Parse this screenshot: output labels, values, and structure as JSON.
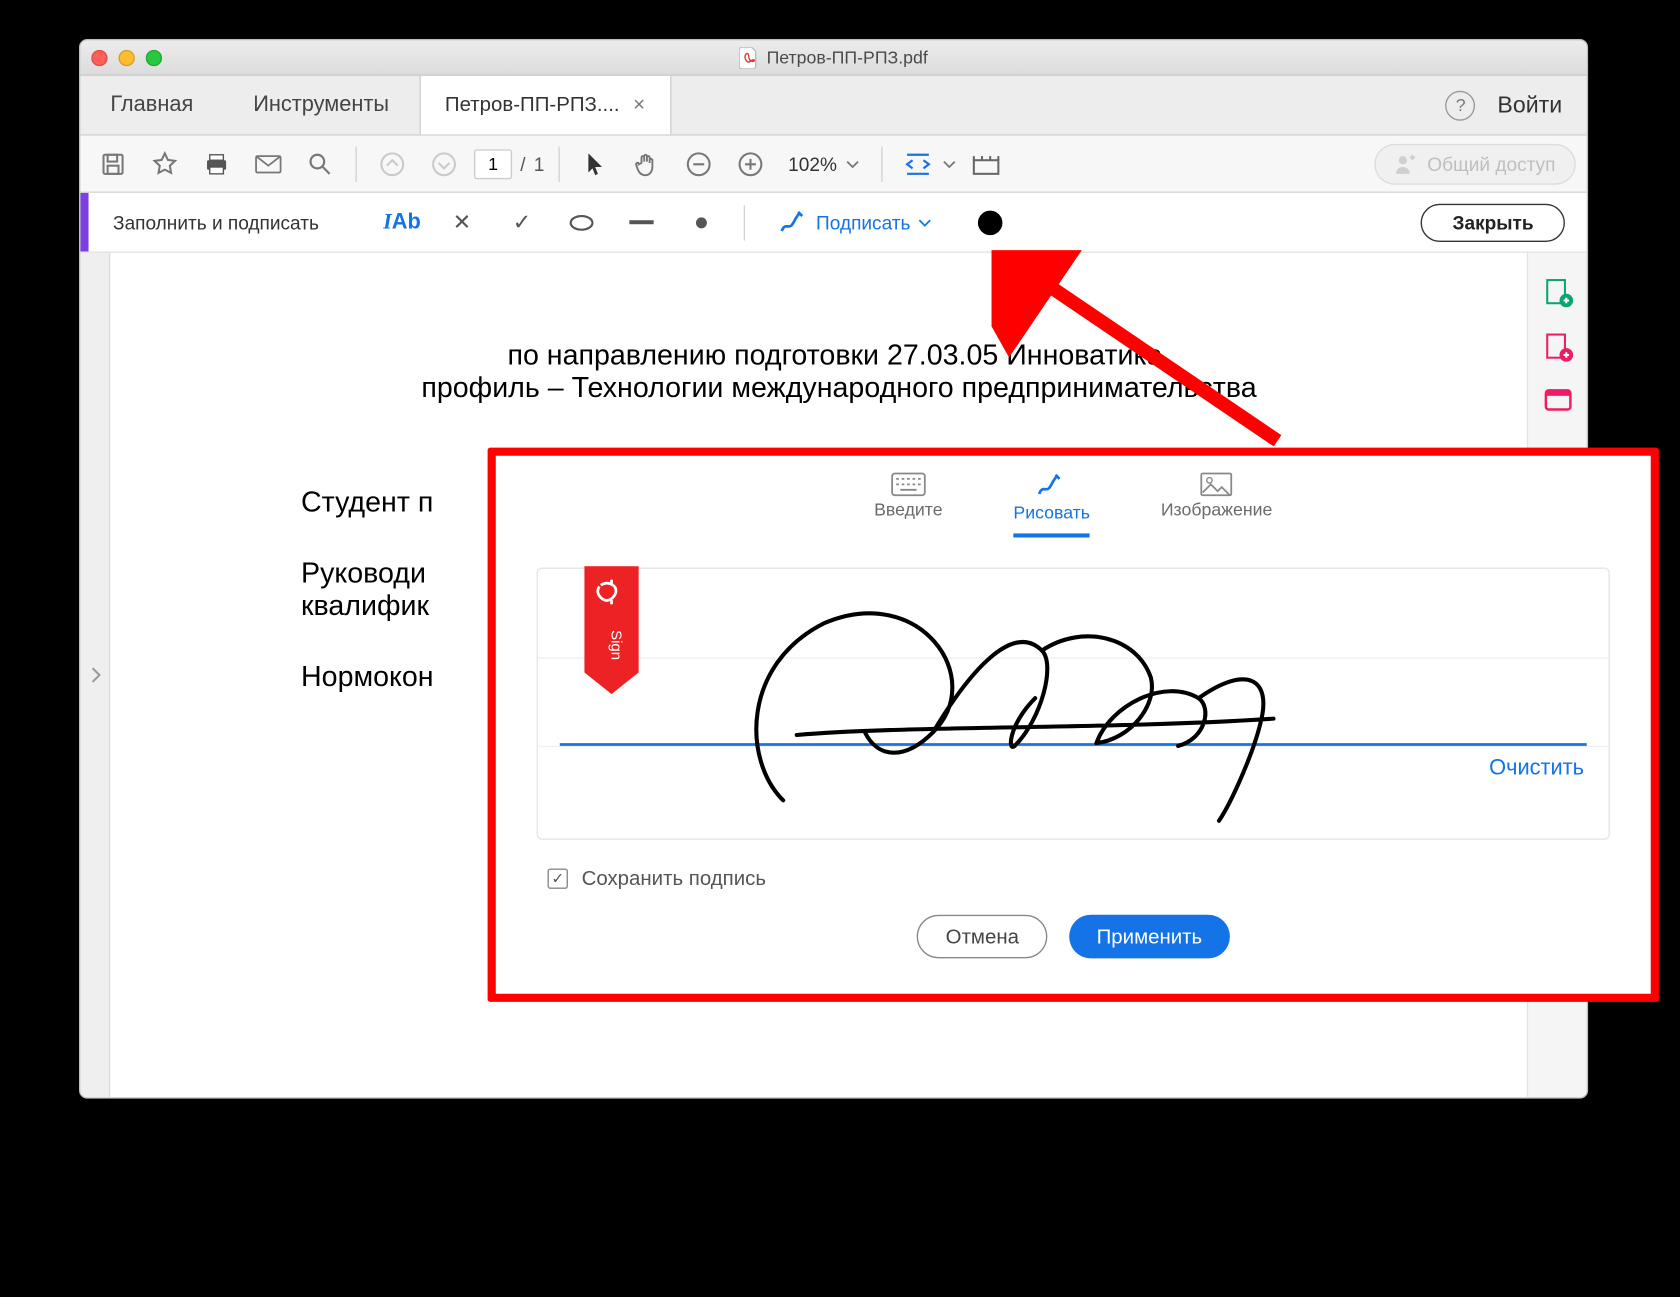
{
  "window": {
    "title": "Петров-ПП-РПЗ.pdf"
  },
  "tabs": {
    "home": "Главная",
    "tools": "Инструменты",
    "active": "Петров-ПП-РПЗ....",
    "login": "Войти"
  },
  "toolbar": {
    "page_current": "1",
    "page_sep": "/",
    "page_total": "1",
    "zoom": "102%",
    "share": "Общий доступ"
  },
  "fillsign": {
    "title": "Заполнить и подписать",
    "ab_label": "Ab",
    "sign": "Подписать",
    "close": "Закрыть"
  },
  "document": {
    "line1": "по направлению подготовки 27.03.05 Инноватика,",
    "line2": "профиль – Технологии международного предпринимательства",
    "student": "Студент п",
    "supervisor1": "Руководи",
    "supervisor2": "квалифик",
    "norm": "Нормокон"
  },
  "dialog": {
    "tab_type": "Введите",
    "tab_draw": "Рисовать",
    "tab_image": "Изображение",
    "clear": "Очистить",
    "save_checkbox": "Сохранить подпись",
    "cancel": "Отмена",
    "apply": "Применить",
    "ribbon_text": "Sign"
  }
}
